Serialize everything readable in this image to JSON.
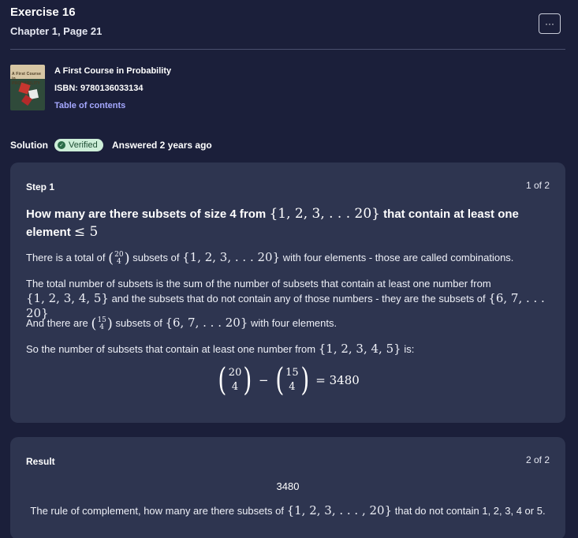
{
  "header": {
    "title": "Exercise 16",
    "subtitle": "Chapter 1, Page 21",
    "more_label": "···"
  },
  "book": {
    "cover_text": "A First Course in PROBABILITY",
    "title": "A First Course in Probability",
    "isbn": "ISBN: 9780136033134",
    "toc_label": "Table of contents"
  },
  "solution": {
    "label": "Solution",
    "badge": "Verified",
    "answered": "Answered 2 years ago"
  },
  "step1": {
    "label": "Step 1",
    "count": "1 of 2",
    "heading_pre": "How many are there subsets of size 4 from",
    "heading_set": "{1, 2, 3, . . . 20}",
    "heading_post": "that contain at least one",
    "heading_line2": "element",
    "heading_le": "≤ 5",
    "p1_pre": "There is a total of",
    "p1_binom_top": "20",
    "p1_binom_bottom": "4",
    "p1_mid": "subsets of",
    "p1_set": "{1, 2, 3, . . . 20}",
    "p1_post": "with four elements - those are called combinations.",
    "p2_line1": "The total number of subsets is the sum of the number of subsets that contain at least one number from",
    "p2_set1": "{1, 2, 3, 4, 5}",
    "p2_mid": "and the subsets that do not contain any of those numbers - they are the subsets of",
    "p2_set2": "{6, 7, . . . 20}",
    "p3_pre": "And there are",
    "p3_binom_top": "15",
    "p3_binom_bottom": "4",
    "p3_mid": "subsets of",
    "p3_set": "{6, 7, . . . 20}",
    "p3_post": "with four elements.",
    "p4_pre": "So the number of subsets that contain at least one number from",
    "p4_set": "{1, 2, 3, 4, 5}",
    "p4_post": "is:",
    "f_b1_top": "20",
    "f_b1_bottom": "4",
    "f_minus": "−",
    "f_b2_top": "15",
    "f_b2_bottom": "4",
    "f_result": "= 3480"
  },
  "result": {
    "label": "Result",
    "count": "2 of 2",
    "value": "3480",
    "text_pre": "The rule of complement, how many are there subsets of",
    "text_set": "{1, 2, 3, . . . , 20}",
    "text_post": "that do not contain 1, 2, 3, 4 or 5."
  }
}
